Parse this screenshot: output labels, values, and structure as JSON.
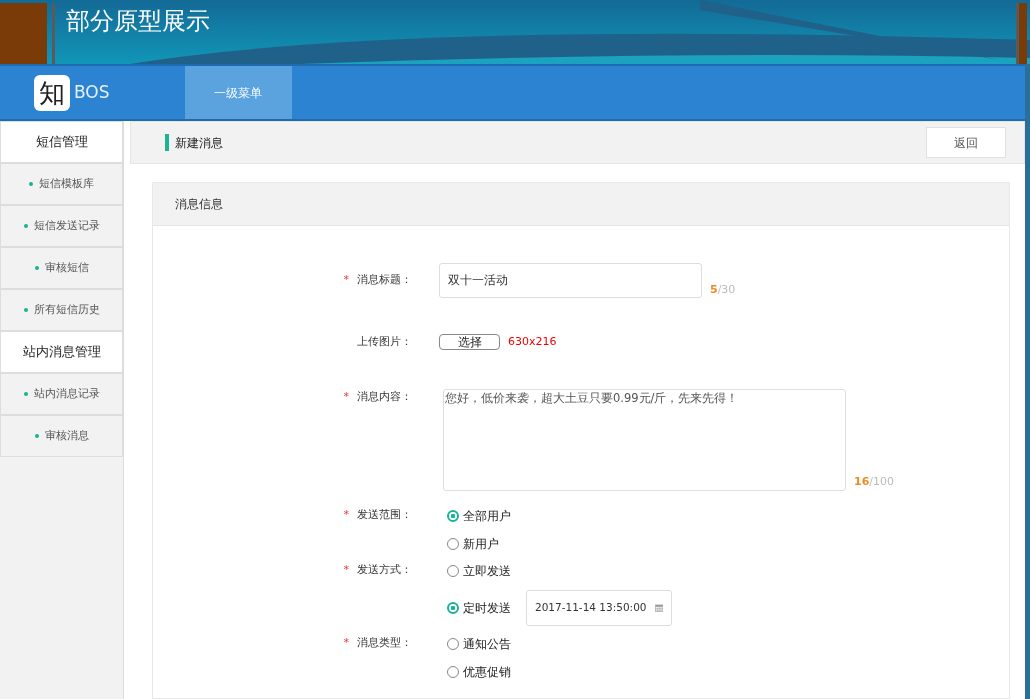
{
  "banner": {
    "title": "部分原型展示"
  },
  "navbar": {
    "logo_char": "知",
    "brand": "BOS",
    "menu": [
      {
        "label": "一级菜单",
        "selected": true
      }
    ]
  },
  "sidebar": [
    {
      "title": "短信管理",
      "items": [
        "短信模板库",
        "短信发送记录",
        "审核短信",
        "所有短信历史"
      ]
    },
    {
      "title": "站内消息管理",
      "items": [
        "站内消息记录",
        "审核消息"
      ]
    }
  ],
  "page_header": {
    "title": "新建消息",
    "back_button": "返回"
  },
  "panel": {
    "title": "消息信息",
    "fields": [
      {
        "kind": "text",
        "label": "消息标题：",
        "required_mark": "*",
        "value": "双十一活动",
        "count": "5",
        "max": "/30"
      },
      {
        "kind": "upload",
        "label": "上传图片：",
        "button": "选择",
        "hint": "630x216"
      },
      {
        "kind": "textarea",
        "label": "消息内容：",
        "required_mark": "*",
        "value": "您好，低价来袭，超大土豆只要0.99元/斤，先来先得！",
        "count": "16",
        "max": "/100"
      },
      {
        "kind": "radio",
        "label": "发送范围：",
        "required_mark": "*",
        "options": [
          {
            "label": "全部用户",
            "selected": true
          },
          {
            "label": "新用户",
            "selected": false
          }
        ]
      },
      {
        "kind": "radio",
        "label": "发送方式：",
        "required_mark": "*",
        "options": [
          {
            "label": "立即发送",
            "selected": false
          },
          {
            "label": "定时发送",
            "selected": true,
            "datetime": "2017-11-14 13:50:00"
          }
        ]
      },
      {
        "kind": "radio",
        "label": "消息类型：",
        "required_mark": "*",
        "options": [
          {
            "label": "通知公告",
            "selected": false
          },
          {
            "label": "优惠促销",
            "selected": false
          }
        ]
      }
    ]
  }
}
